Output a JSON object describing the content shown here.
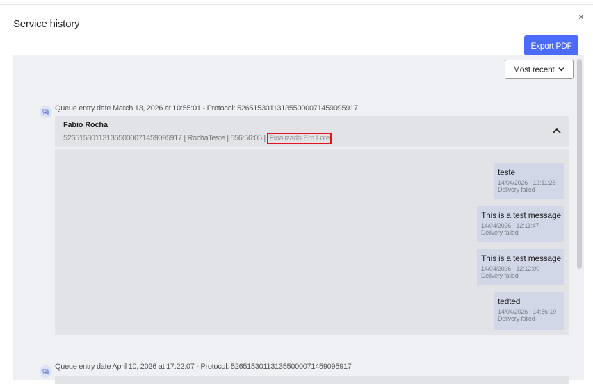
{
  "modal": {
    "title": "Service history",
    "close_label": "×",
    "export_label": "Export PDF"
  },
  "sort": {
    "selected": "Most recent"
  },
  "entries": [
    {
      "header": "Queue entry date March 13, 2026 at 10:55:01 - Protocol: 52651530113135500007145909591 7",
      "name": "Fabio Rocha",
      "meta": "526515301131355000071459095917 | RochaTeste | 556:56:05 | ",
      "status": "Finalizado Em Lote",
      "messages": [
        {
          "text": "teste",
          "time": "14/04/2026 - 12:11:28",
          "status": "Delivery failed"
        },
        {
          "text": "This is a test message",
          "time": "14/04/2026 - 12:11:47",
          "status": "Delivery failed"
        },
        {
          "text": "This is a test message",
          "time": "14/04/2026 - 12:12:00",
          "status": "Delivery failed"
        },
        {
          "text": "tedted",
          "time": "14/04/2026 - 14:56:19",
          "status": "Delivery failed"
        }
      ]
    },
    {
      "header": "Queue entry date April 10, 2026 at 17:22:07 - Protocol: 526515301131355000071459095917"
    }
  ],
  "colors": {
    "accent": "#4b6bfb",
    "highlight_border": "#e2141d",
    "bubble": "#d2d7e8",
    "panel": "#e2e3e6"
  }
}
